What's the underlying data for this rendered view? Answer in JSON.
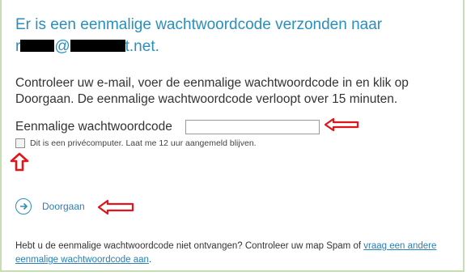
{
  "header": {
    "title_line1": "Er is een eenmalige wachtwoordcode verzonden naar",
    "email_start": "r",
    "email_at": "@",
    "email_end": "t.net."
  },
  "instructions": "Controleer uw e-mail, voer de eenmalige wachtwoordcode in en klik op Doorgaan. De eenmalige wachtwoordcode verloopt over 15 minuten.",
  "otp": {
    "label": "Eenmalige wachtwoordcode",
    "value": ""
  },
  "remember": {
    "label": "Dit is een privécomputer. Laat me 12 uur aangemeld blijven.",
    "checked": false
  },
  "continue_button": {
    "label": "Doorgaan",
    "icon": "arrow-right-circle-icon"
  },
  "footer": {
    "text": "Hebt u de eenmalige wachtwoordcode niet ontvangen? Controleer uw map Spam of ",
    "link": "vraag een andere eenmalige wachtwoordcode aan",
    "suffix": "."
  },
  "colors": {
    "title": "#2a8fbd",
    "link": "#2a7fb5",
    "annotation_arrow": "#e0161b",
    "frame_border": "#c6dfb2"
  }
}
